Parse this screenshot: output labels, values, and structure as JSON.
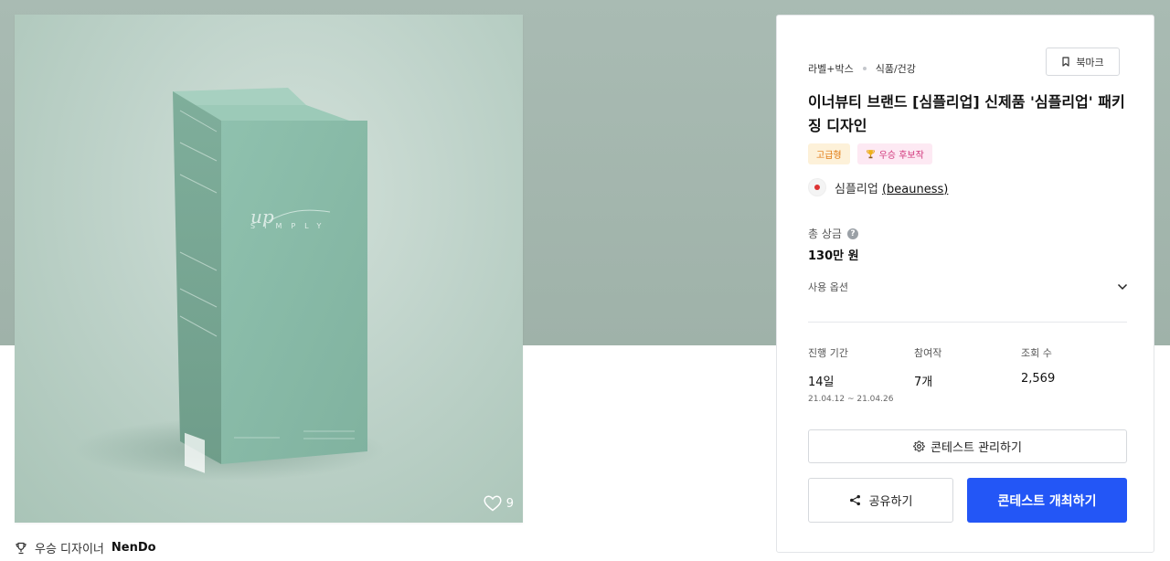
{
  "theme": {
    "accent": "#2356f6",
    "product_color": "#8fbfae"
  },
  "hero": {
    "brand_script": "up",
    "brand_name": "SIMPLY",
    "like_icon": "heart-icon",
    "like_count": "9"
  },
  "winner": {
    "icon": "trophy-icon",
    "label": "우승 디자이너",
    "name": "NenDo"
  },
  "panel": {
    "breadcrumb": [
      "라벨+박스",
      "식품/건강"
    ],
    "bookmark_label": "북마크",
    "title": "이너뷰티 브랜드 [심플리업] 신제품 '심플리업' 패키징 디자인",
    "badges": {
      "premium": "고급형",
      "candidate": "우승 후보작"
    },
    "host": {
      "name": "심플리업",
      "handle": "(beauness)"
    },
    "prize": {
      "label": "총 상금",
      "value": "130만 원"
    },
    "options_label": "사용 옵션",
    "stats": {
      "period": {
        "label": "진행 기간",
        "value": "14일",
        "range": "21.04.12 ~ 21.04.26"
      },
      "entries": {
        "label": "참여작",
        "value": "7개"
      },
      "views": {
        "label": "조회 수",
        "value": "2,569"
      }
    },
    "manage_label": "콘테스트 관리하기",
    "share_label": "공유하기",
    "host_contest_label": "콘테스트 개최하기"
  }
}
